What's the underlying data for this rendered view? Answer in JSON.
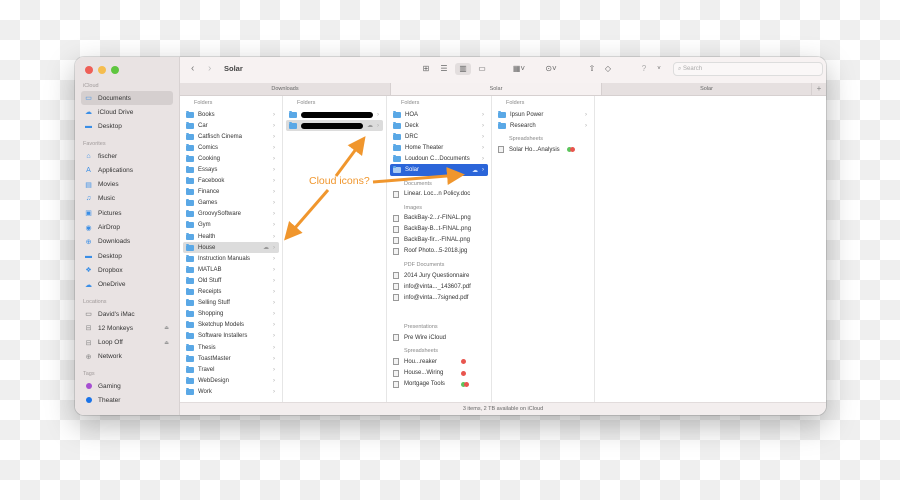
{
  "window": {
    "title": "Solar",
    "traffic_lights": [
      "close",
      "minimize",
      "zoom"
    ]
  },
  "toolbar": {
    "back_icon": "chevron-left-icon",
    "forward_icon": "chevron-right-icon",
    "view_icons": [
      "icon-view-icon",
      "list-view-icon",
      "column-view-icon",
      "gallery-view-icon"
    ],
    "active_view": "column-view-icon",
    "group_icon": "group-icon",
    "action_icon": "action-icon",
    "share_icon": "share-icon",
    "tag_icon": "tag-icon",
    "help_icon": "question-icon",
    "search_placeholder": "Search"
  },
  "tabs": [
    {
      "label": "Downloads",
      "active": false
    },
    {
      "label": "Solar",
      "active": true
    },
    {
      "label": "Solar",
      "active": false
    }
  ],
  "sidebar": {
    "sections": [
      {
        "title": "iCloud",
        "items": [
          {
            "label": "Documents",
            "icon": "document-icon",
            "active": true
          },
          {
            "label": "iCloud Drive",
            "icon": "cloud-icon"
          },
          {
            "label": "Desktop",
            "icon": "desktop-icon"
          }
        ]
      },
      {
        "title": "Favorites",
        "items": [
          {
            "label": "fischer",
            "icon": "home-icon"
          },
          {
            "label": "Applications",
            "icon": "applications-icon"
          },
          {
            "label": "Movies",
            "icon": "movies-icon"
          },
          {
            "label": "Music",
            "icon": "music-icon"
          },
          {
            "label": "Pictures",
            "icon": "pictures-icon"
          },
          {
            "label": "AirDrop",
            "icon": "airdrop-icon"
          },
          {
            "label": "Downloads",
            "icon": "downloads-icon"
          },
          {
            "label": "Desktop",
            "icon": "desktop-icon"
          },
          {
            "label": "Dropbox",
            "icon": "dropbox-icon"
          },
          {
            "label": "OneDrive",
            "icon": "onedrive-icon"
          }
        ]
      },
      {
        "title": "Locations",
        "items": [
          {
            "label": "David's iMac",
            "icon": "imac-icon"
          },
          {
            "label": "12 Monkeys",
            "icon": "drive-icon",
            "eject": true
          },
          {
            "label": "Loop Off",
            "icon": "drive-icon",
            "eject": true
          },
          {
            "label": "Network",
            "icon": "network-icon"
          }
        ]
      },
      {
        "title": "Tags",
        "items": [
          {
            "label": "Gaming",
            "color": "#a64fd1"
          },
          {
            "label": "Theater",
            "color": "#1a73e8"
          }
        ]
      }
    ]
  },
  "columns": {
    "col1": {
      "header": "Folders",
      "items": [
        "Books",
        "Car",
        "Catfisch Cinema",
        "Comics",
        "Cooking",
        "Essays",
        "Facebook",
        "Finance",
        "Games",
        "GroovySoftware",
        "Gym",
        "Health",
        "House",
        "Instruction Manuals",
        "MATLAB",
        "Old Stuff",
        "Receipts",
        "Selling Stuff",
        "Shopping",
        "Sketchup Models",
        "Software Installers",
        "Thesis",
        "ToastMaster",
        "Travel",
        "WebDesign",
        "Work"
      ],
      "selected": "House"
    },
    "col2": {
      "header": "Folders",
      "items": [
        "[redacted]",
        "[redacted]"
      ],
      "selected_index": 1
    },
    "col3": {
      "folders_header": "Folders",
      "folders": [
        "HOA",
        "Deck",
        "DRC",
        "Home Theater",
        "Loudoun C...Documents",
        "Solar"
      ],
      "selected": "Solar",
      "groups": [
        {
          "header": "Documents",
          "items": [
            "Linear. Loc...n Policy.doc"
          ]
        },
        {
          "header": "Images",
          "items": [
            "BackBay-2...r-FINAL.png",
            "BackBay-B...t-FINAL.png",
            "BackBay-fir...-FINAL.png",
            "Roof Photo...5-2018.jpg"
          ]
        },
        {
          "header": "PDF Documents",
          "items": [
            "2014 Jury Questionnaire",
            "info@vinta..._143607.pdf",
            "info@vinta...7signed.pdf"
          ]
        },
        {
          "header": "Presentations",
          "items": [
            "Pre Wire iCloud"
          ]
        },
        {
          "header": "Spreadsheets",
          "items": [
            "Hou...reaker",
            "House...Wiring",
            "Mortgage Tools"
          ]
        }
      ]
    },
    "col4": {
      "folders_header": "Folders",
      "folders": [
        "Ipsun Power",
        "Research"
      ],
      "spreadsheets_header": "Spreadsheets",
      "spreadsheets": [
        "Solar Ho...Analysis"
      ]
    }
  },
  "status": "3 items, 2 TB available on iCloud",
  "annotation": {
    "label": "Cloud icons?",
    "color": "#f0962d"
  }
}
